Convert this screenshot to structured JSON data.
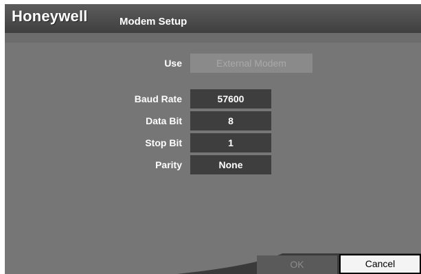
{
  "header": {
    "logo": "Honeywell",
    "title": "Modem Setup"
  },
  "use": {
    "label": "Use",
    "value": "External Modem"
  },
  "fields": [
    {
      "label": "Baud Rate",
      "value": "57600"
    },
    {
      "label": "Data Bit",
      "value": "8"
    },
    {
      "label": "Stop Bit",
      "value": "1"
    },
    {
      "label": "Parity",
      "value": "None"
    }
  ],
  "buttons": {
    "ok": "OK",
    "cancel": "Cancel"
  }
}
